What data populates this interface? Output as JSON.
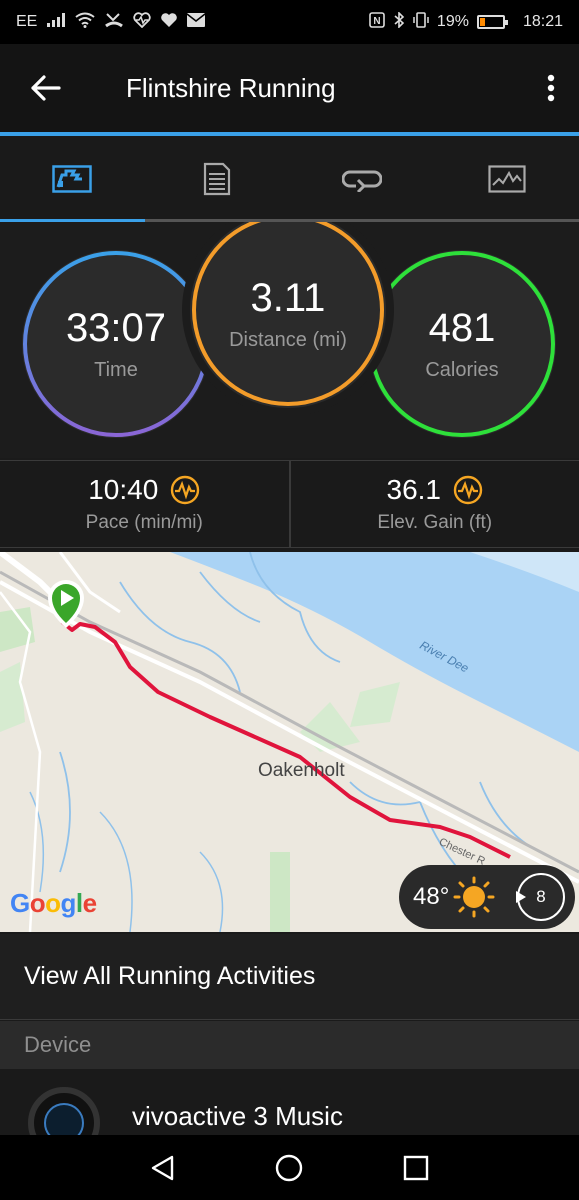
{
  "status_bar": {
    "carrier": "EE",
    "battery_percent": "19%",
    "battery_level": 0.19,
    "time": "18:21",
    "left_icons": [
      "signal-icon",
      "wifi-icon",
      "missed-call-icon",
      "heart-rate-icon",
      "heart-icon",
      "mail-icon"
    ],
    "right_icons": [
      "nfc-icon",
      "bluetooth-icon",
      "vibrate-icon",
      "battery-icon"
    ]
  },
  "app_bar": {
    "title": "Flintshire Running",
    "back_icon": "back-arrow-icon",
    "menu_icon": "more-vert-icon",
    "accent_color": "#3aa0e8"
  },
  "tabs": [
    {
      "name": "overview",
      "icon": "overview-icon",
      "active": true
    },
    {
      "name": "details",
      "icon": "details-icon",
      "active": false
    },
    {
      "name": "laps",
      "icon": "laps-icon",
      "active": false
    },
    {
      "name": "charts",
      "icon": "chart-icon",
      "active": false
    }
  ],
  "summary": {
    "time": {
      "value": "33:07",
      "label": "Time"
    },
    "distance": {
      "value": "3.11",
      "label": "Distance (mi)"
    },
    "calories": {
      "value": "481",
      "label": "Calories"
    }
  },
  "stats": {
    "pace": {
      "value": "10:40",
      "label": "Pace (min/mi)"
    },
    "elev_gain": {
      "value": "36.1",
      "label": "Elev. Gain (ft)"
    }
  },
  "colors": {
    "time_ring": "#3aa0e8",
    "distance_ring": "#f39c2a",
    "calories_ring": "#2ee03a",
    "route": "#e0143c",
    "start_marker": "#3aa62a",
    "stat_icon": "#f5a623"
  },
  "map": {
    "town_label": "Oakenholt",
    "river_label": "River Dee",
    "road_label": "Chester R",
    "logo": "Google",
    "weather": {
      "temperature": "48°",
      "condition_icon": "sun-icon",
      "wind_speed": "8"
    }
  },
  "view_all": "View All Running Activities",
  "device_section": {
    "header": "Device",
    "device_name": "vivoactive 3 Music"
  },
  "nav_bar": {
    "icons": [
      "nav-back-icon",
      "nav-home-icon",
      "nav-recents-icon"
    ]
  }
}
